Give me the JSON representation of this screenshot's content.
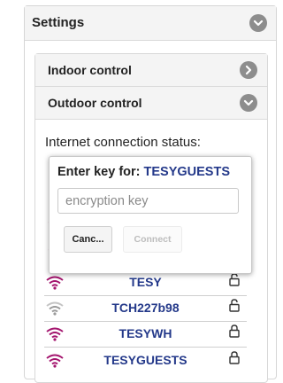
{
  "colors": {
    "wifi_strong": "#a4156e",
    "wifi_weak": "#9a9a9a",
    "network_name": "#24398a",
    "chevron_bg": "#8d8d8d"
  },
  "settings": {
    "title": "Settings",
    "toggle_icon": "chevron-down-icon"
  },
  "sections": {
    "indoor": {
      "label": "Indoor control",
      "icon": "chevron-right-icon"
    },
    "outdoor": {
      "label": "Outdoor control",
      "icon": "chevron-down-icon"
    }
  },
  "connection": {
    "status_label": "Internet connection status:"
  },
  "modal": {
    "title_prefix": "Enter key for: ",
    "network": "TESYGUESTS",
    "input_placeholder": "encryption key",
    "cancel_label": "Canc...",
    "connect_label": "Connect"
  },
  "networks": [
    {
      "name": "TESY",
      "signal": "strong",
      "lock": "unlocked"
    },
    {
      "name": "TCH227b98",
      "signal": "weak",
      "lock": "unlocked"
    },
    {
      "name": "TESYWH",
      "signal": "strong",
      "lock": "locked"
    },
    {
      "name": "TESYGUESTS",
      "signal": "strong",
      "lock": "locked"
    }
  ]
}
